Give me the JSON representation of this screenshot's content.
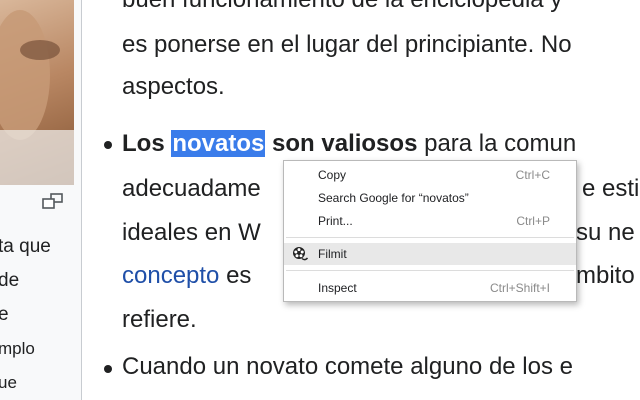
{
  "sidebar": {
    "lines": [
      "ta que",
      "de",
      "e",
      "mplo",
      "ue"
    ]
  },
  "article": {
    "line1": "buen funcionamiento de la enciclopedia y",
    "line2": "es ponerse en el lugar del principiante. No",
    "line3": "aspectos.",
    "b1_bold1": "Los",
    "b1_selected": "novatos",
    "b1_bold2": "son valiosos",
    "b1_rest": "para la comun",
    "line5_a": "adecuadame",
    "line5_b": "e estim",
    "line6_a": "ideales en W",
    "line6_b": "su ne",
    "line7_link": "concepto",
    "line7_a": "es",
    "line7_b": "mbito d",
    "line8": "refiere.",
    "b2": "Cuando un novato comete alguno de los e"
  },
  "context_menu": {
    "items": [
      {
        "label": "Copy",
        "shortcut": "Ctrl+C"
      },
      {
        "label": "Search Google for “novatos”",
        "shortcut": ""
      },
      {
        "label": "Print...",
        "shortcut": "Ctrl+P"
      },
      {
        "label": "Filmit",
        "shortcut": "",
        "icon": "filmit-film-reel-icon"
      },
      {
        "label": "Inspect",
        "shortcut": "Ctrl+Shift+I"
      }
    ]
  }
}
